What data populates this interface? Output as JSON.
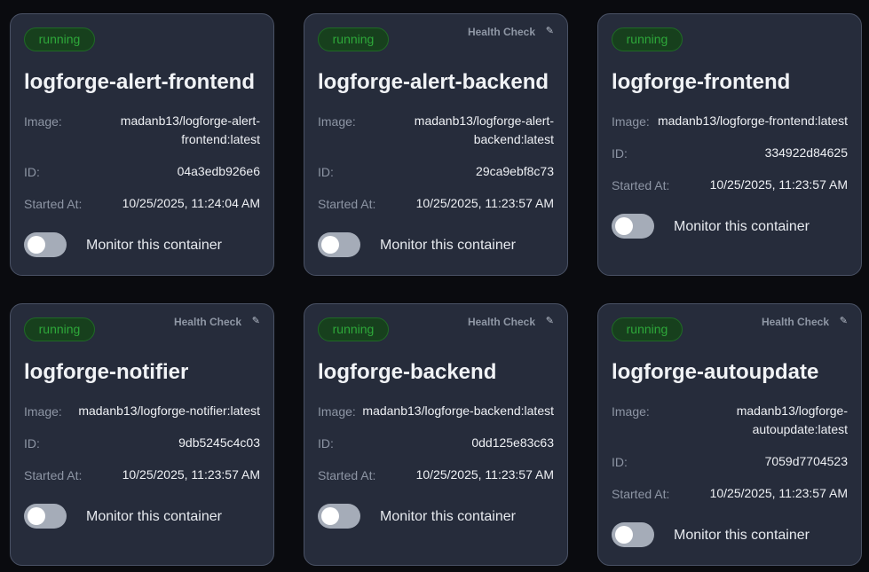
{
  "cards": [
    {
      "status": "running",
      "health_label": "",
      "name": "logforge-alert-frontend",
      "image_label": "Image:",
      "image_line1": "madanb13/logforge-alert-",
      "image_line2": "frontend:latest",
      "id_label": "ID:",
      "id": "04a3edb926e6",
      "started_label": "Started At:",
      "started": "10/25/2025, 11:24:04 AM",
      "monitor_label": "Monitor this container",
      "monitor_enabled": false
    },
    {
      "status": "running",
      "health_label": "Health Check",
      "name": "logforge-alert-backend",
      "image_label": "Image:",
      "image_line1": "madanb13/logforge-alert-",
      "image_line2": "backend:latest",
      "id_label": "ID:",
      "id": "29ca9ebf8c73",
      "started_label": "Started At:",
      "started": "10/25/2025, 11:23:57 AM",
      "monitor_label": "Monitor this container",
      "monitor_enabled": false
    },
    {
      "status": "running",
      "health_label": "",
      "name": "logforge-frontend",
      "image_label": "Image:",
      "image_line1": "madanb13/logforge-frontend:latest",
      "image_line2": "",
      "id_label": "ID:",
      "id": "334922d84625",
      "started_label": "Started At:",
      "started": "10/25/2025, 11:23:57 AM",
      "monitor_label": "Monitor this container",
      "monitor_enabled": false
    },
    {
      "status": "running",
      "health_label": "Health Check",
      "name": "logforge-notifier",
      "image_label": "Image:",
      "image_line1": "madanb13/logforge-notifier:latest",
      "image_line2": "",
      "id_label": "ID:",
      "id": "9db5245c4c03",
      "started_label": "Started At:",
      "started": "10/25/2025, 11:23:57 AM",
      "monitor_label": "Monitor this container",
      "monitor_enabled": false
    },
    {
      "status": "running",
      "health_label": "Health Check",
      "name": "logforge-backend",
      "image_label": "Image:",
      "image_line1": "madanb13/logforge-backend:latest",
      "image_line2": "",
      "id_label": "ID:",
      "id": "0dd125e83c63",
      "started_label": "Started At:",
      "started": "10/25/2025, 11:23:57 AM",
      "monitor_label": "Monitor this container",
      "monitor_enabled": false
    },
    {
      "status": "running",
      "health_label": "Health Check",
      "name": "logforge-autoupdate",
      "image_label": "Image:",
      "image_line1": "madanb13/logforge-",
      "image_line2": "autoupdate:latest",
      "id_label": "ID:",
      "id": "7059d7704523",
      "started_label": "Started At:",
      "started": "10/25/2025, 11:23:57 AM",
      "monitor_label": "Monitor this container",
      "monitor_enabled": false
    }
  ],
  "icons": {
    "health_edit": "pencil-icon"
  },
  "colors": {
    "page_background": "#0a0b0f",
    "card_background": "#262c3b",
    "status_running": "#2ea83a",
    "toggle_off": "#a5acb8"
  }
}
